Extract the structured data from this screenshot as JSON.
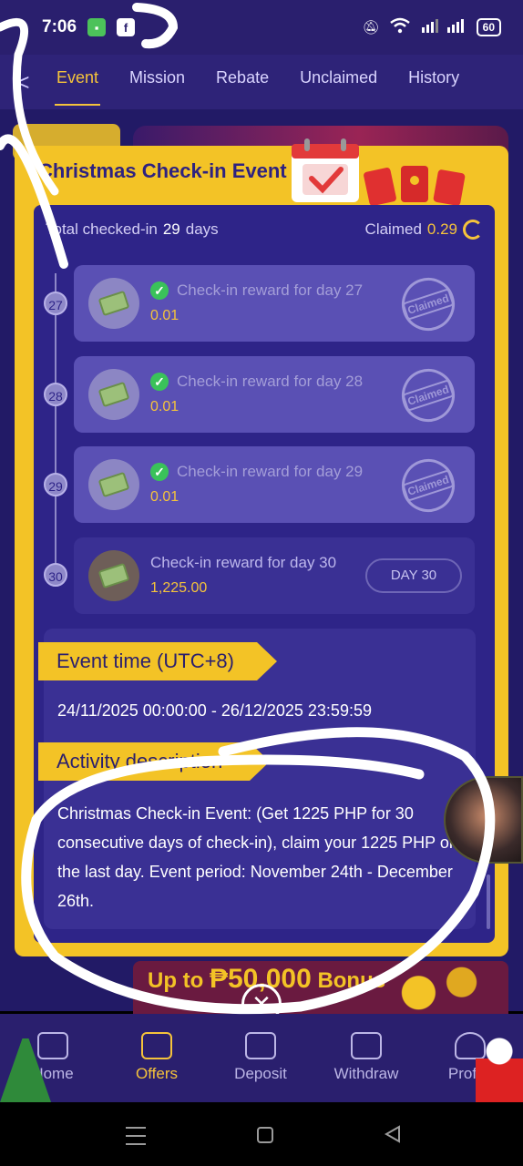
{
  "status_bar": {
    "time": "7:06",
    "battery": "60",
    "icons": [
      "messages-icon",
      "facebook-icon",
      "mute-icon",
      "wifi-icon",
      "signal-icon"
    ]
  },
  "tabs": {
    "back": "<",
    "items": [
      {
        "label": "Event",
        "active": true
      },
      {
        "label": "Mission",
        "active": false
      },
      {
        "label": "Rebate",
        "active": false
      },
      {
        "label": "Unclaimed",
        "active": false
      },
      {
        "label": "History",
        "active": false
      }
    ]
  },
  "modal": {
    "title": "Christmas Check-in Event",
    "summary": {
      "total_label": "Total checked-in",
      "total_value": "29",
      "total_unit": "days",
      "claimed_label": "Claimed",
      "claimed_value": "0.29"
    },
    "rewards": [
      {
        "day": "27",
        "label": "Check-in reward for day 27",
        "amount": "0.01",
        "status": "Claimed"
      },
      {
        "day": "28",
        "label": "Check-in reward for day 28",
        "amount": "0.01",
        "status": "Claimed"
      },
      {
        "day": "29",
        "label": "Check-in reward for day 29",
        "amount": "0.01",
        "status": "Claimed"
      },
      {
        "day": "30",
        "label": "Check-in reward for day 30",
        "amount": "1,225.00",
        "button": "DAY 30"
      }
    ],
    "event_time_title": "Event time (UTC+8)",
    "event_time_value": "24/11/2025 00:00:00 - 26/12/2025 23:59:59",
    "description_title": "Activity description",
    "description_text": "Christmas Check-in Event: (Get 1225 PHP for 30 consecutive days of check-in), claim your 1225 PHP on the last day. Event period: November 24th - December 26th."
  },
  "promo": {
    "prefix": "Up to",
    "amount": "₱50,000",
    "suffix": "Bonus"
  },
  "bottom_nav": [
    {
      "label": "Home",
      "icon": "home-icon"
    },
    {
      "label": "Offers",
      "icon": "gift-icon",
      "active": true
    },
    {
      "label": "Deposit",
      "icon": "wallet-icon"
    },
    {
      "label": "Withdraw",
      "icon": "withdraw-icon"
    },
    {
      "label": "Profile",
      "icon": "profile-icon"
    }
  ],
  "colors": {
    "accent_yellow": "#f3c326",
    "panel_purple": "#2e2488",
    "card_purple": "#5a50b4",
    "annotation_white": "#ffffff"
  }
}
